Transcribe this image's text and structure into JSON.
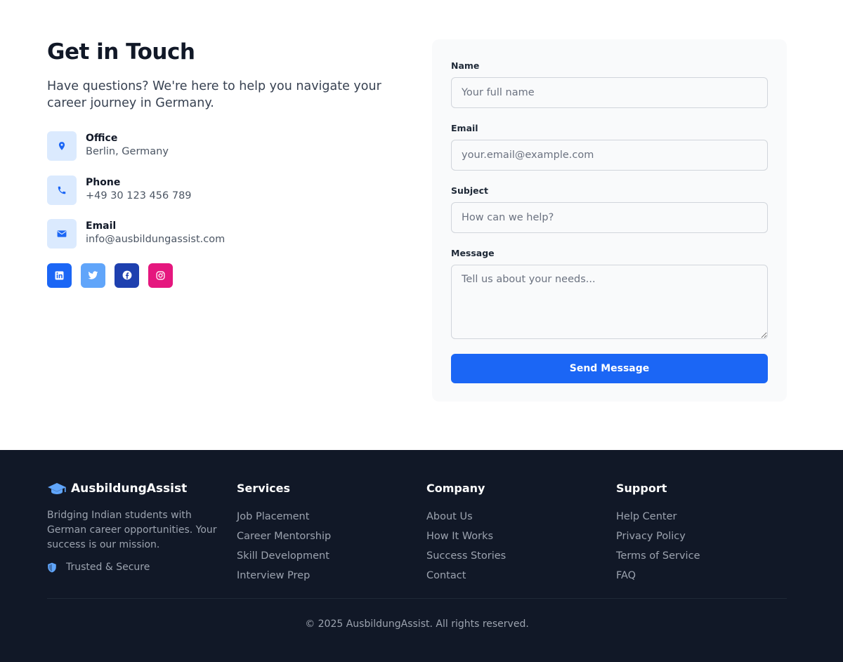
{
  "contact": {
    "title": "Get in Touch",
    "intro": "Have questions? We're here to help you navigate your career journey in Germany.",
    "info": [
      {
        "label": "Office",
        "value": "Berlin, Germany",
        "icon": "map-pin-icon"
      },
      {
        "label": "Phone",
        "value": "+49 30 123 456 789",
        "icon": "phone-icon"
      },
      {
        "label": "Email",
        "value": "info@ausbildungassist.com",
        "icon": "envelope-icon"
      }
    ],
    "socials": [
      {
        "icon": "linkedin-icon",
        "color": "#1b66f5"
      },
      {
        "icon": "twitter-icon",
        "color": "#60a5fa"
      },
      {
        "icon": "facebook-icon",
        "color": "#1e40af"
      },
      {
        "icon": "instagram-icon",
        "color": "#e5177e"
      }
    ]
  },
  "form": {
    "name_label": "Name",
    "name_placeholder": "Your full name",
    "email_label": "Email",
    "email_placeholder": "your.email@example.com",
    "subject_label": "Subject",
    "subject_placeholder": "How can we help?",
    "message_label": "Message",
    "message_placeholder": "Tell us about your needs...",
    "submit_label": "Send Message"
  },
  "footer": {
    "brand": "AusbildungAssist",
    "brand_icon": "graduation-cap-icon",
    "description": "Bridging Indian students with German career opportunities. Your success is our mission.",
    "trusted": "Trusted & Secure",
    "columns": [
      {
        "title": "Services",
        "links": [
          "Job Placement",
          "Career Mentorship",
          "Skill Development",
          "Interview Prep"
        ]
      },
      {
        "title": "Company",
        "links": [
          "About Us",
          "How It Works",
          "Success Stories",
          "Contact"
        ]
      },
      {
        "title": "Support",
        "links": [
          "Help Center",
          "Privacy Policy",
          "Terms of Service",
          "FAQ"
        ]
      }
    ],
    "copyright": "© 2025 AusbildungAssist. All rights reserved."
  },
  "colors": {
    "accent": "#1b66f5",
    "icon_bg": "#dbeafe",
    "footer_bg": "#111827"
  }
}
